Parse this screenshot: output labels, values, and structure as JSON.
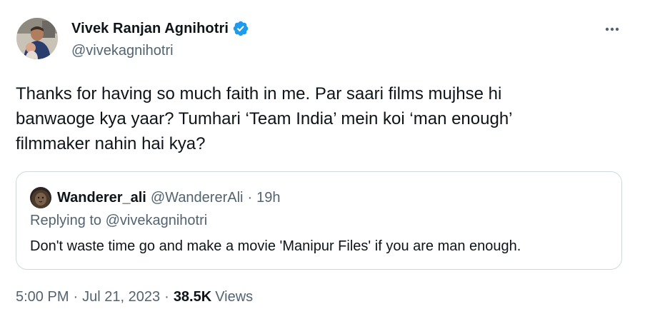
{
  "author": {
    "display_name": "Vivek Ranjan Agnihotri",
    "handle": "@vivekagnihotri",
    "verified": true,
    "avatar_icon": "profile-photo-avatar"
  },
  "menu": {
    "more_icon": "more-horizontal-icon"
  },
  "tweet": {
    "lines": [
      "Thanks for having so much faith in me. Par saari films mujhse hi",
      "banwaoge kya yaar? Tumhari ‘Team India’ mein koi ‘man enough’",
      "filmmaker nahin hai kya?"
    ]
  },
  "quote": {
    "display_name": "Wanderer_ali",
    "handle": "@WandererAli",
    "separator": "·",
    "time": "19h",
    "replying_to": "Replying to @vivekagnihotri",
    "text": "Don't waste time go and make a movie 'Manipur Files' if you are man enough."
  },
  "meta": {
    "time": "5:00 PM",
    "separator": "·",
    "date": "Jul 21, 2023",
    "views_count": "38.5K",
    "views_label": "Views"
  },
  "colors": {
    "text_primary": "#0f1419",
    "text_secondary": "#536471",
    "verified_blue": "#1d9bf0",
    "border": "#cfd9de"
  }
}
